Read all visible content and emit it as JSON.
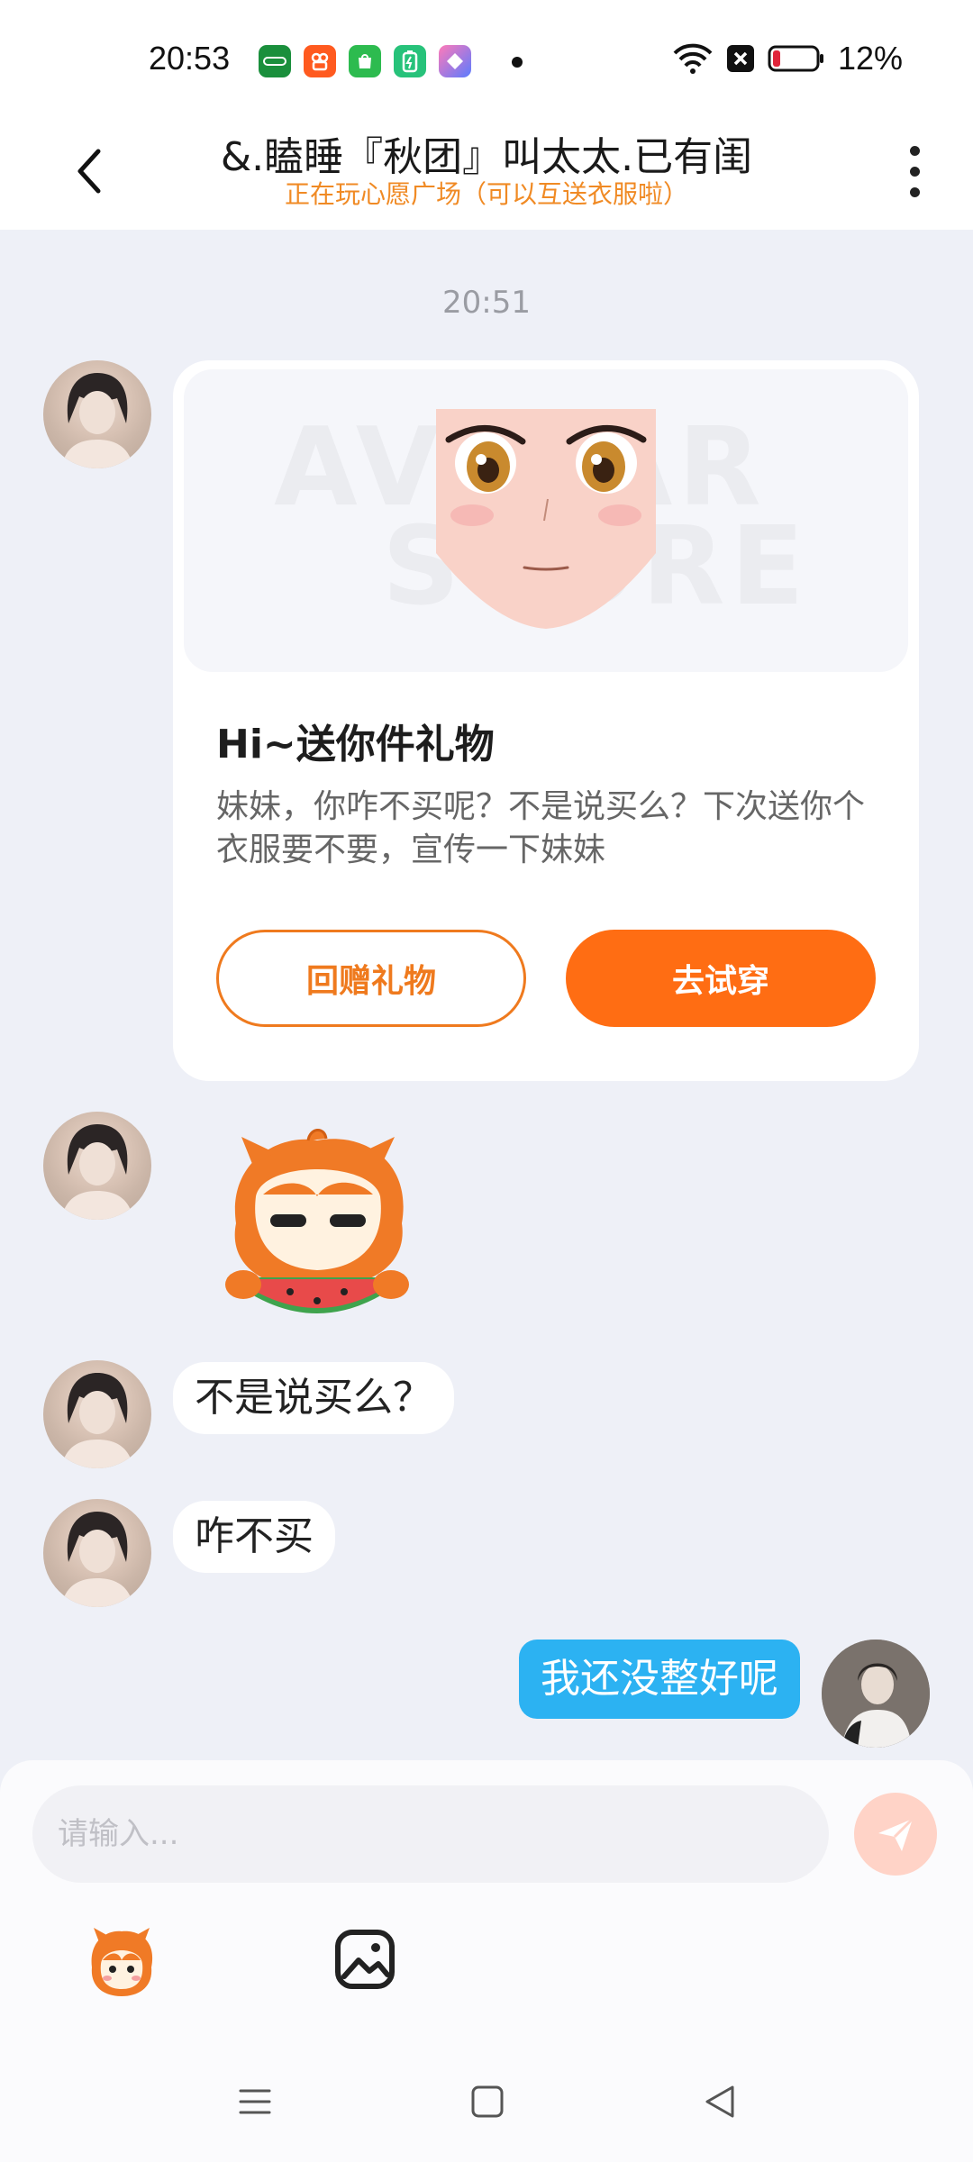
{
  "status_bar": {
    "time": "20:53",
    "battery": "12%",
    "icons": [
      "oppo-store-icon",
      "kuaishou-icon",
      "app-market-icon",
      "battery-app-icon",
      "shortcut-app-icon",
      "wifi-icon",
      "no-sim-icon",
      "battery-icon"
    ]
  },
  "header": {
    "title": "&.瞌睡『秋团』叫太太.已有闺",
    "subtitle": "正在玩心愿广场（可以互送衣服啦）"
  },
  "chat": {
    "timestamp": "20:51",
    "gift_card": {
      "title": "Hi~送你件礼物",
      "description": "妹妹，你咋不买呢？不是说买么？下次送你个衣服要不要，宣传一下妹妹",
      "return_gift_label": "回赠礼物",
      "try_on_label": "去试穿"
    },
    "messages": [
      {
        "from": "other",
        "text": "不是说买么？"
      },
      {
        "from": "other",
        "text": "咋不买"
      },
      {
        "from": "me",
        "text": "我还没整好呢"
      }
    ]
  },
  "input": {
    "placeholder": "请输入..."
  },
  "colors": {
    "accent_orange": "#ff6d13",
    "subtitle_orange": "#f08a24",
    "my_bubble_blue": "#2cb2f2",
    "background": "#eef0f7"
  }
}
